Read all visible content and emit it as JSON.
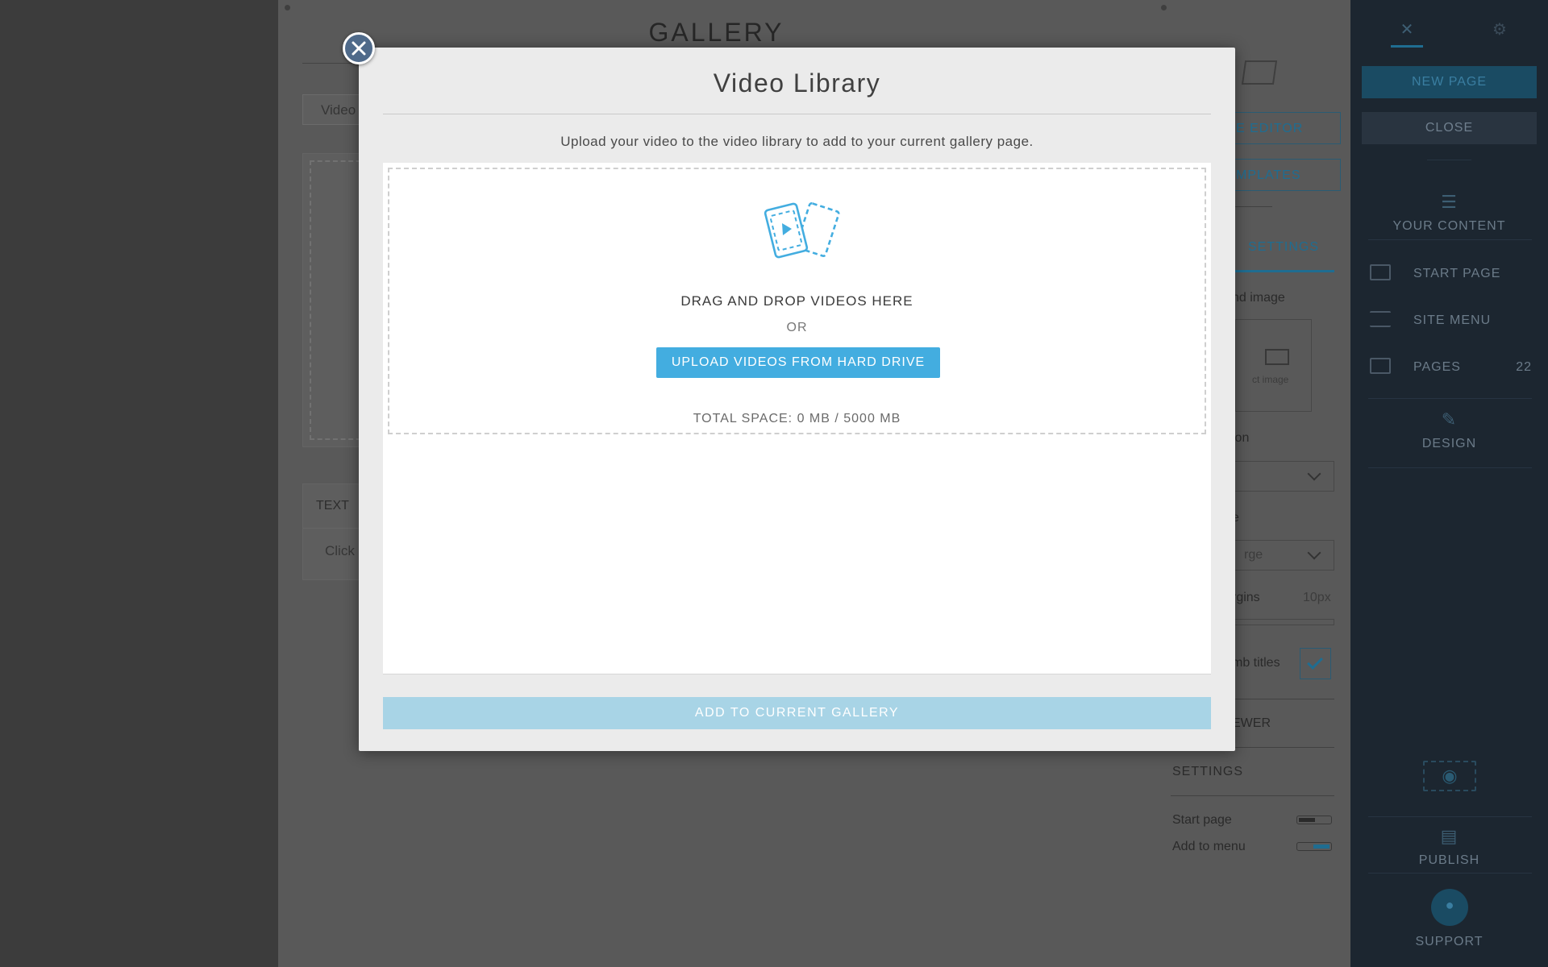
{
  "background_page": {
    "gallery_title": "GALLERY",
    "video_tab_label": "Video",
    "text_block_header": "TEXT",
    "text_block_body": "Click"
  },
  "settings_panel": {
    "page_editor_button": "E EDITOR",
    "templates_button": "MPLATES",
    "settings_tab": "SETTINGS",
    "background_image_label": "nd image",
    "select_image_text": "ct image",
    "position_label": "ion",
    "size_label": "e",
    "size_value": "rge",
    "margins_label": "rgins",
    "margins_value": "10px",
    "thumb_titles_label": "mb titles",
    "viewer_label": "EWER",
    "settings_label": "SETTINGS",
    "start_page_label": "Start page",
    "add_to_menu_label": "Add to menu"
  },
  "sidebar": {
    "new_page_button": "NEW PAGE",
    "close_button": "CLOSE",
    "your_content": "YOUR CONTENT",
    "start_page": "START PAGE",
    "site_menu": "SITE MENU",
    "pages": "PAGES",
    "pages_count": "22",
    "design": "DESIGN",
    "publish": "PUBLISH",
    "support": "SUPPORT"
  },
  "modal": {
    "title": "Video Library",
    "subtitle": "Upload your video to the video library to add to your current gallery page.",
    "drag_drop_text": "DRAG AND DROP VIDEOS HERE",
    "or_text": "OR",
    "upload_button": "UPLOAD VIDEOS FROM HARD DRIVE",
    "total_space": "TOTAL SPACE: 0 MB / 5000 MB",
    "add_button": "ADD TO CURRENT GALLERY"
  },
  "colors": {
    "accent": "#43ade0",
    "accent_disabled": "#a8d4e6",
    "modal_bg": "#ebebeb",
    "sidebar_bg": "#1c2630",
    "overlay": "#4a4a4a"
  },
  "icons": [
    "close-icon",
    "video-files-icon",
    "tools-icon",
    "gear-icon",
    "layers-icon",
    "start-page-icon",
    "menu-icon",
    "pages-icon",
    "design-icon",
    "eye-icon",
    "publish-icon",
    "chat-icon",
    "chevron-down-icon",
    "checkmark-icon"
  ]
}
